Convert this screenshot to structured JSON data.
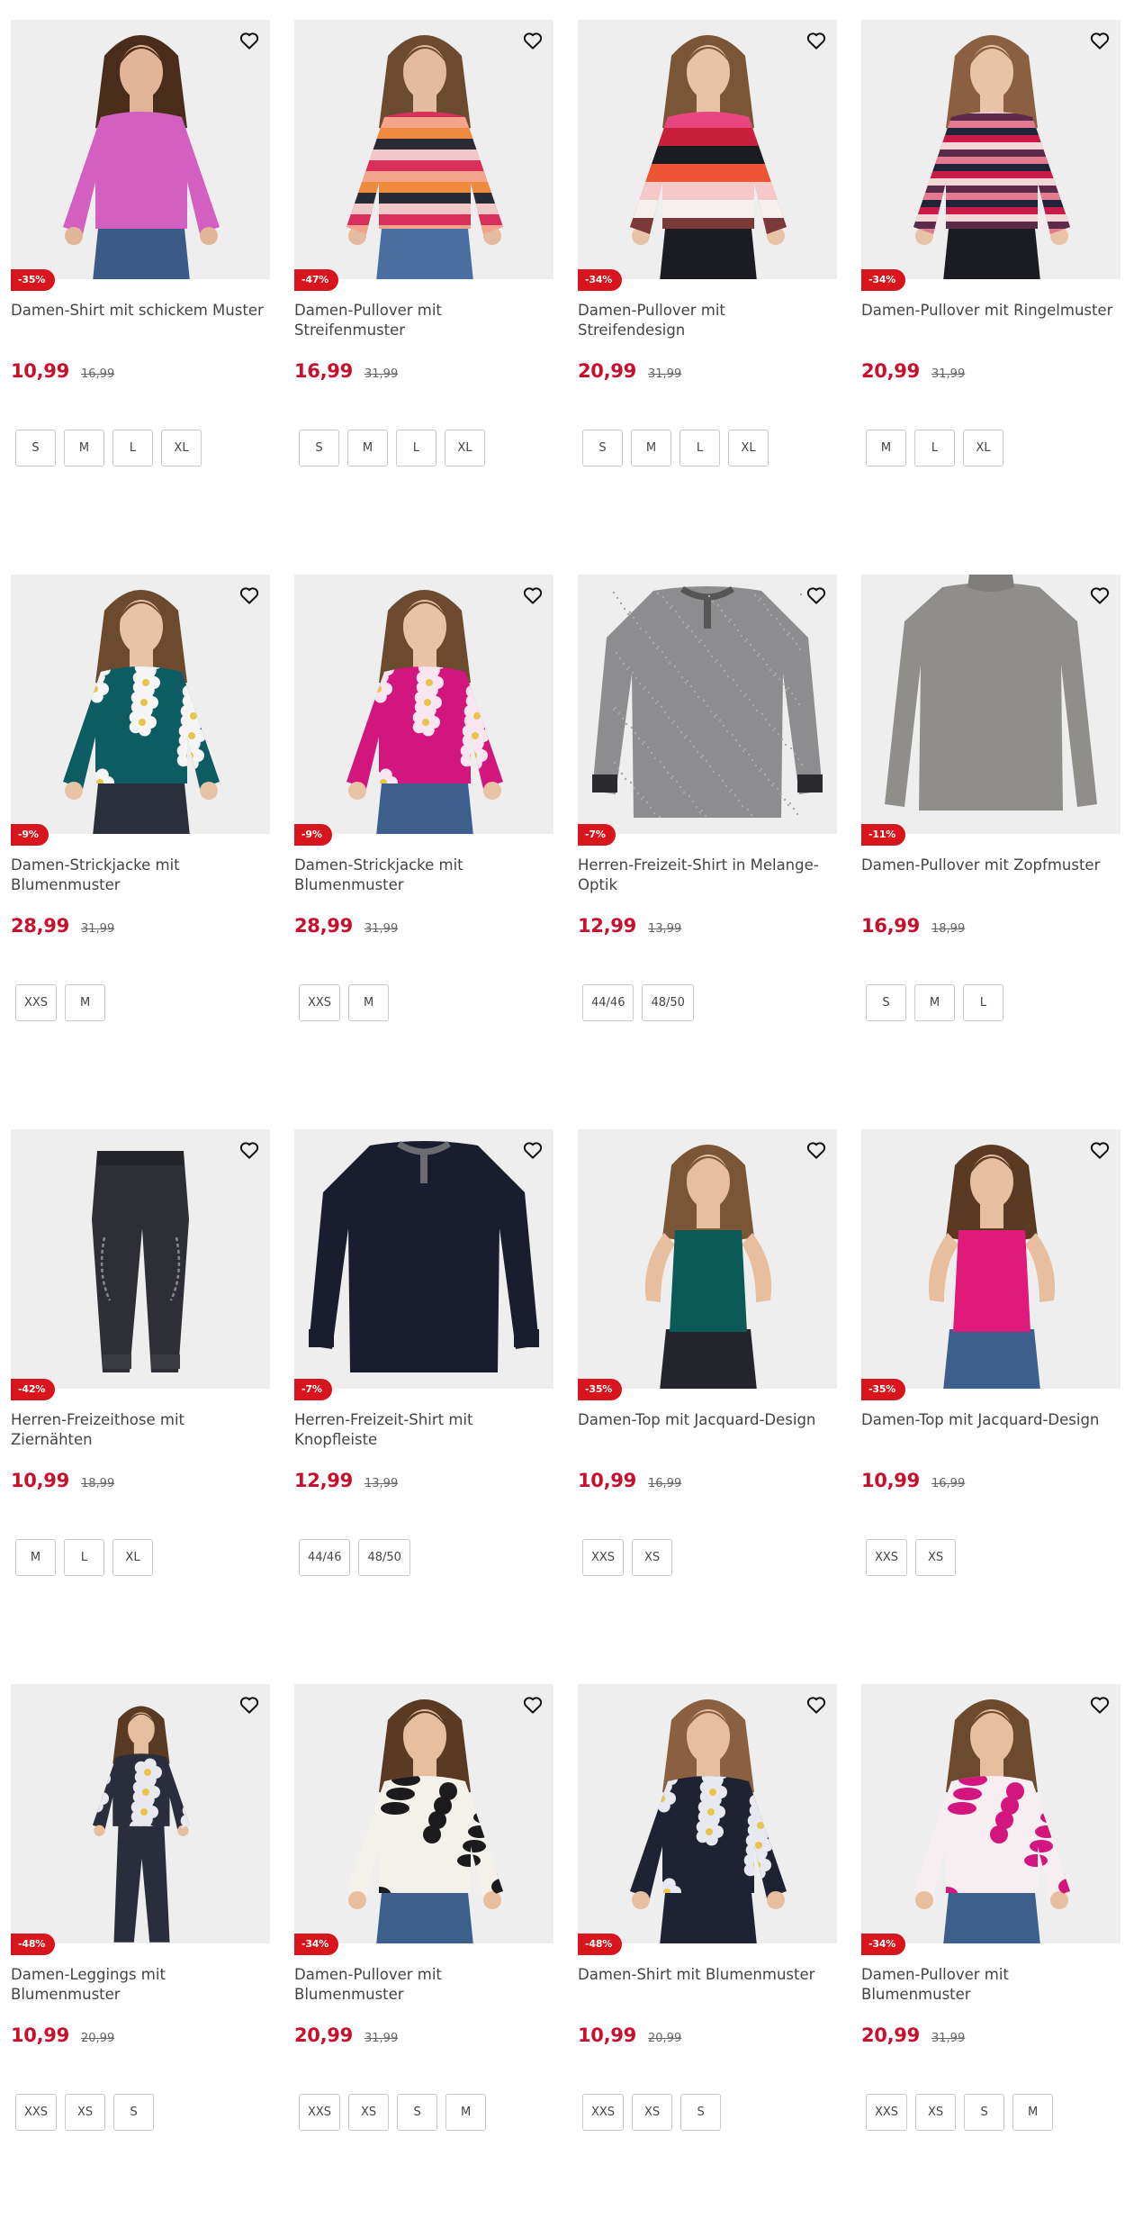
{
  "colors": {
    "accent": "#d8141d",
    "price": "#c8102e"
  },
  "products": [
    {
      "title": "Damen-Shirt mit schickem Muster",
      "price": "10,99",
      "old_price": "16,99",
      "discount": "-35%",
      "sizes": [
        "S",
        "M",
        "L",
        "XL"
      ],
      "image": "woman-pink-top"
    },
    {
      "title": "Damen-Pullover mit Streifenmuster",
      "price": "16,99",
      "old_price": "31,99",
      "discount": "-47%",
      "sizes": [
        "S",
        "M",
        "L",
        "XL"
      ],
      "image": "woman-striped-pullover"
    },
    {
      "title": "Damen-Pullover mit Streifendesign",
      "price": "20,99",
      "old_price": "31,99",
      "discount": "-34%",
      "sizes": [
        "S",
        "M",
        "L",
        "XL"
      ],
      "image": "woman-wide-stripe-pullover"
    },
    {
      "title": "Damen-Pullover mit Ringelmuster",
      "price": "20,99",
      "old_price": "31,99",
      "discount": "-34%",
      "sizes": [
        "M",
        "L",
        "XL"
      ],
      "image": "woman-ringel-pullover"
    },
    {
      "title": "Damen-Strickjacke mit Blumenmuster",
      "price": "28,99",
      "old_price": "31,99",
      "discount": "-9%",
      "sizes": [
        "XXS",
        "M"
      ],
      "image": "woman-teal-flower-cardigan"
    },
    {
      "title": "Damen-Strickjacke mit Blumenmuster",
      "price": "28,99",
      "old_price": "31,99",
      "discount": "-9%",
      "sizes": [
        "XXS",
        "M"
      ],
      "image": "woman-pink-flower-cardigan"
    },
    {
      "title": "Herren-Freizeit-Shirt in Melange-Optik",
      "price": "12,99",
      "old_price": "13,99",
      "discount": "-7%",
      "sizes": [
        "44/46",
        "48/50"
      ],
      "image": "grey-longsleeve"
    },
    {
      "title": "Damen-Pullover mit Zopfmuster",
      "price": "16,99",
      "old_price": "18,99",
      "discount": "-11%",
      "sizes": [
        "S",
        "M",
        "L"
      ],
      "image": "grey-pullover"
    },
    {
      "title": "Herren-Freizeithose mit Ziernähten",
      "price": "10,99",
      "old_price": "18,99",
      "discount": "-42%",
      "sizes": [
        "M",
        "L",
        "XL"
      ],
      "image": "dark-joggers"
    },
    {
      "title": "Herren-Freizeit-Shirt mit Knopfleiste",
      "price": "12,99",
      "old_price": "13,99",
      "discount": "-7%",
      "sizes": [
        "44/46",
        "48/50"
      ],
      "image": "navy-longsleeve"
    },
    {
      "title": "Damen-Top mit Jacquard-Design",
      "price": "10,99",
      "old_price": "16,99",
      "discount": "-35%",
      "sizes": [
        "XXS",
        "XS"
      ],
      "image": "woman-teal-top"
    },
    {
      "title": "Damen-Top mit Jacquard-Design",
      "price": "10,99",
      "old_price": "16,99",
      "discount": "-35%",
      "sizes": [
        "XXS",
        "XS"
      ],
      "image": "woman-magenta-top"
    },
    {
      "title": "Damen-Leggings mit Blumenmuster",
      "price": "10,99",
      "old_price": "20,99",
      "discount": "-48%",
      "sizes": [
        "XXS",
        "XS",
        "S"
      ],
      "image": "woman-flower-leggings"
    },
    {
      "title": "Damen-Pullover mit Blumenmuster",
      "price": "20,99",
      "old_price": "31,99",
      "discount": "-34%",
      "sizes": [
        "XXS",
        "XS",
        "S",
        "M"
      ],
      "image": "woman-bw-pullover"
    },
    {
      "title": "Damen-Shirt mit Blumenmuster",
      "price": "10,99",
      "old_price": "20,99",
      "discount": "-48%",
      "sizes": [
        "XXS",
        "XS",
        "S"
      ],
      "image": "woman-navy-flower-shirt"
    },
    {
      "title": "Damen-Pullover mit Blumenmuster",
      "price": "20,99",
      "old_price": "31,99",
      "discount": "-34%",
      "sizes": [
        "XXS",
        "XS",
        "S",
        "M"
      ],
      "image": "woman-pink-pattern-pullover"
    }
  ]
}
